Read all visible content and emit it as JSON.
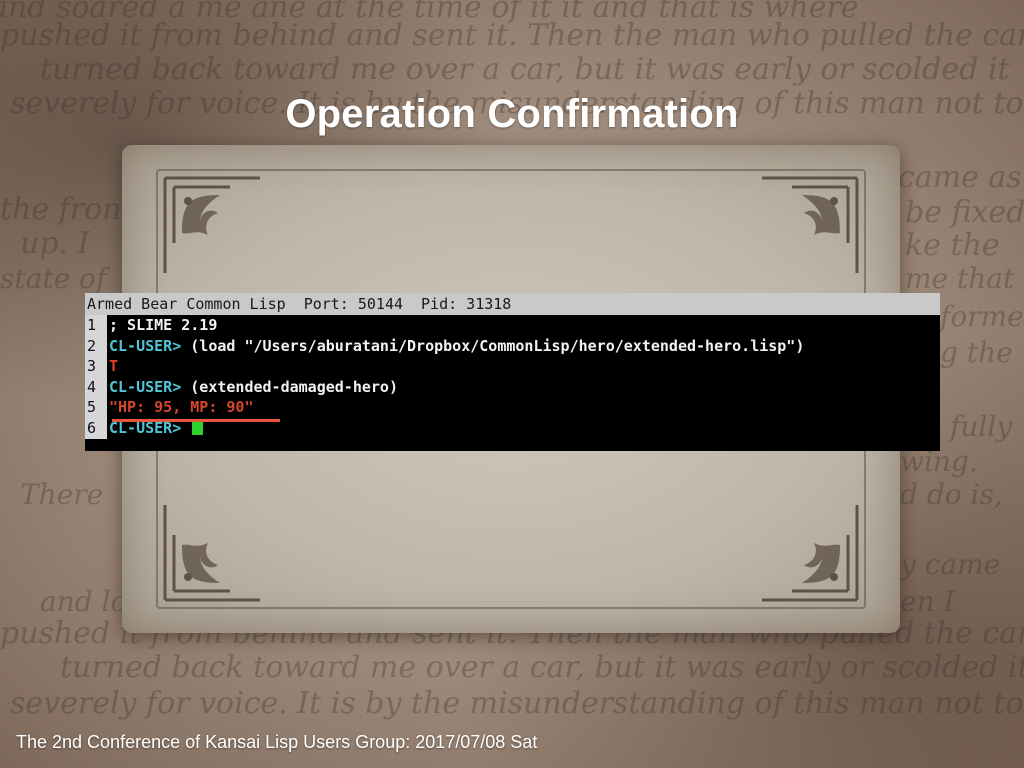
{
  "slide": {
    "title": "Operation Confirmation",
    "footer": "The 2nd Conference of Kansai Lisp Users Group: 2017/07/08 Sat"
  },
  "terminal": {
    "header": {
      "app": "Armed Bear Common Lisp",
      "port": "Port: 50144",
      "pid": "Pid: 31318"
    },
    "lines": [
      {
        "num": "1",
        "prompt": "",
        "text": "; SLIME 2.19"
      },
      {
        "num": "2",
        "prompt": "CL-USER>",
        "text": " (load \"/Users/aburatani/Dropbox/CommonLisp/hero/extended-hero.lisp\")"
      },
      {
        "num": "3",
        "prompt": "",
        "text": "T"
      },
      {
        "num": "4",
        "prompt": "CL-USER>",
        "text": " (extended-damaged-hero)"
      },
      {
        "num": "5",
        "prompt": "",
        "text": "\"HP: 95, MP: 90\""
      },
      {
        "num": "6",
        "prompt": "CL-USER>",
        "text": " "
      }
    ]
  },
  "colors": {
    "prompt": "#4fc6d6",
    "return_value": "#d6452c",
    "highlight_underline": "#e8553a",
    "cursor": "#2fd12f"
  },
  "icons": {
    "cursor": "block-cursor-icon",
    "corners": "ornamental-corner-icon"
  }
}
